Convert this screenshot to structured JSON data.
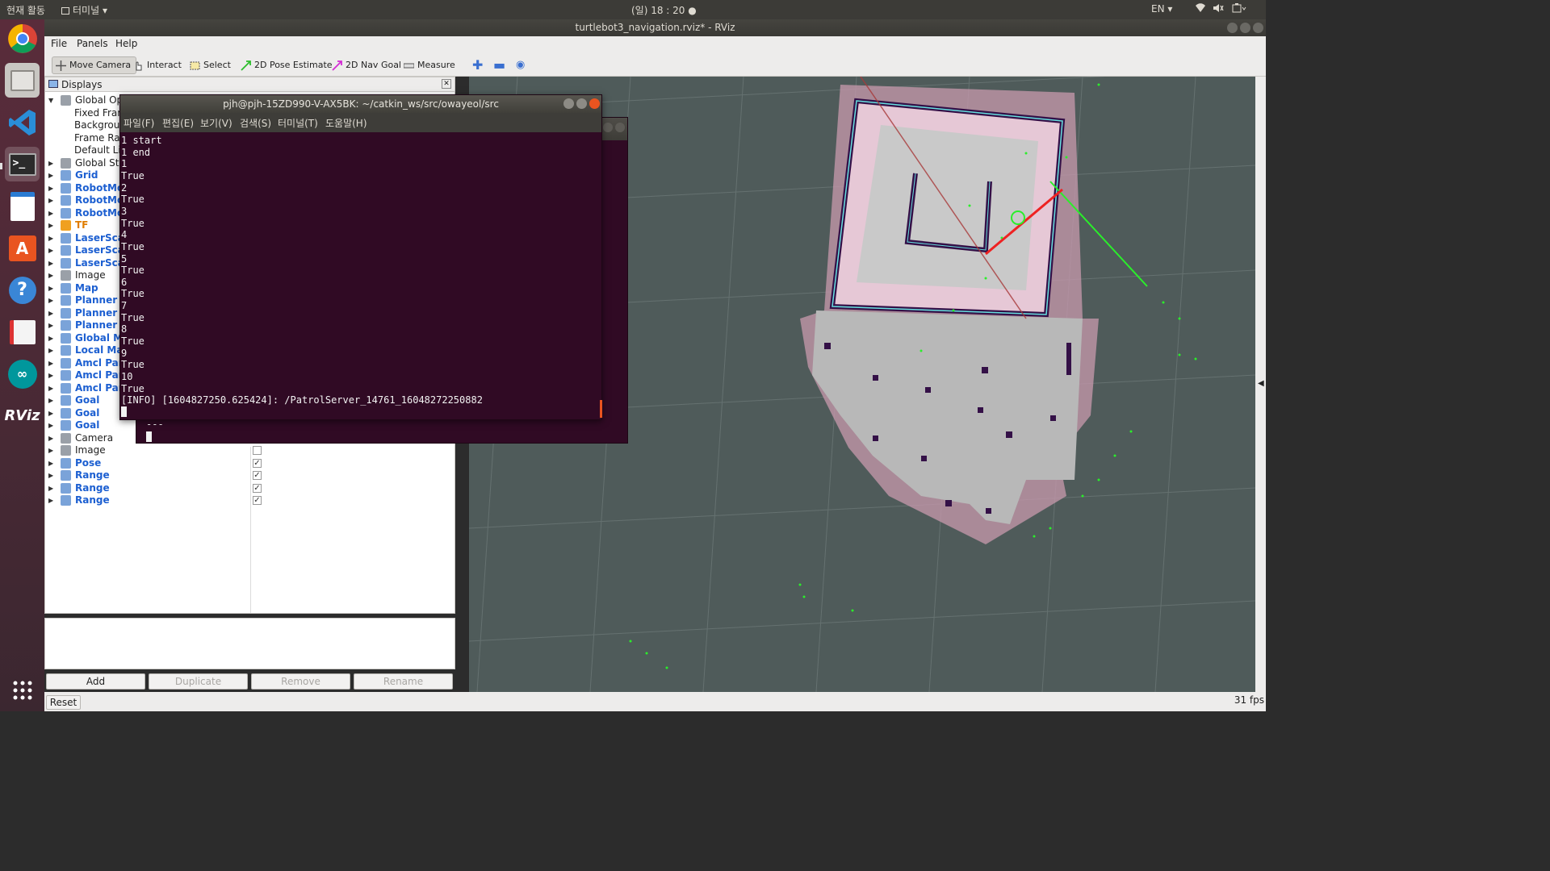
{
  "top_panel": {
    "activities": "현재 활동",
    "app_menu": "터미널",
    "clock": "(일) 18 : 20",
    "lang": "EN"
  },
  "window_title": "turtlebot3_navigation.rviz* - RViz",
  "menu": {
    "file": "File",
    "panels": "Panels",
    "help": "Help"
  },
  "tools": {
    "move_camera": "Move Camera",
    "interact": "Interact",
    "select": "Select",
    "pose_estimate": "2D Pose Estimate",
    "nav_goal": "2D Nav Goal",
    "measure": "Measure"
  },
  "displays": {
    "title": "Displays",
    "rows": [
      {
        "label": "Global Op",
        "style": "normal"
      },
      {
        "label": "Fixed Fram",
        "style": "normal"
      },
      {
        "label": "Backgroun",
        "style": "normal"
      },
      {
        "label": "Frame Rat",
        "style": "normal"
      },
      {
        "label": "Default Li",
        "style": "normal"
      },
      {
        "label": "Global Sta",
        "style": "normal"
      },
      {
        "label": "Grid",
        "style": "blue"
      },
      {
        "label": "RobotMo",
        "style": "blue"
      },
      {
        "label": "RobotMo",
        "style": "blue"
      },
      {
        "label": "RobotMo",
        "style": "blue"
      },
      {
        "label": "TF",
        "style": "orange"
      },
      {
        "label": "LaserScar",
        "style": "blue"
      },
      {
        "label": "LaserScar",
        "style": "blue"
      },
      {
        "label": "LaserScar",
        "style": "blue"
      },
      {
        "label": "Image",
        "style": "normal"
      },
      {
        "label": "Map",
        "style": "blue"
      },
      {
        "label": "Planner P",
        "style": "blue"
      },
      {
        "label": "Planner P",
        "style": "blue"
      },
      {
        "label": "Planner P",
        "style": "blue"
      },
      {
        "label": "Global Ma",
        "style": "blue"
      },
      {
        "label": "Local Ma",
        "style": "blue"
      },
      {
        "label": "Amcl Par",
        "style": "blue"
      },
      {
        "label": "Amcl Par",
        "style": "blue"
      },
      {
        "label": "Amcl Par",
        "style": "blue"
      },
      {
        "label": "Goal",
        "style": "blue"
      },
      {
        "label": "Goal",
        "style": "blue"
      },
      {
        "label": "Goal",
        "style": "blue"
      },
      {
        "label": "Camera",
        "style": "normal"
      },
      {
        "label": "Image",
        "style": "normal"
      },
      {
        "label": "Pose",
        "style": "blue"
      },
      {
        "label": "Range",
        "style": "blue"
      },
      {
        "label": "Range",
        "style": "blue"
      },
      {
        "label": "Range",
        "style": "blue"
      }
    ]
  },
  "buttons": {
    "add": "Add",
    "duplicate": "Duplicate",
    "remove": "Remove",
    "rename": "Rename",
    "reset": "Reset"
  },
  "fps": "31 fps",
  "terminal": {
    "title": "pjh@pjh-15ZD990-V-AX5BK: ~/catkin_ws/src/owayeol/src",
    "menu": [
      "파일(F)",
      "편집(E)",
      "보기(V)",
      "검색(S)",
      "터미널(T)",
      "도움말(H)"
    ],
    "lines": [
      "1 start",
      "1 end",
      "1",
      "True",
      "2",
      "True",
      "3",
      "True",
      "4",
      "True",
      "5",
      "True",
      "6",
      "True",
      "7",
      "True",
      "8",
      "True",
      "9",
      "True",
      "10",
      "True",
      "[INFO] [1604827250.625424]: /PatrolServer_14761_16048272250882"
    ],
    "back_line": "---"
  },
  "colors": {
    "terminal_bg": "#300a24",
    "viewport_bg": "#4f5b5a",
    "accent_blue": "#1c5fd1"
  }
}
